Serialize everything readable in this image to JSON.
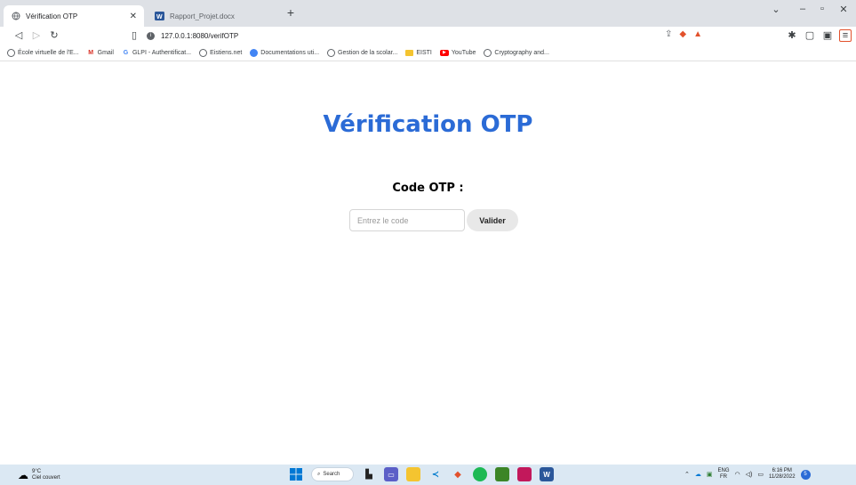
{
  "browser": {
    "tabs": [
      {
        "label": "Vérification OTP",
        "active": true
      },
      {
        "label": "Rapport_Projet.docx",
        "active": false
      }
    ],
    "address": "127.0.0.1:8080/verifOTP",
    "bookmarks": [
      {
        "label": "École virtuelle de l'E...",
        "icon": "globe-icon"
      },
      {
        "label": "Gmail",
        "icon": "gmail-icon"
      },
      {
        "label": "GLPI - Authentificat...",
        "icon": "google-icon"
      },
      {
        "label": "Eistiens.net",
        "icon": "globe-icon"
      },
      {
        "label": "Documentations uti...",
        "icon": "chrome-icon"
      },
      {
        "label": "Gestion de la scolar...",
        "icon": "globe-icon"
      },
      {
        "label": "EISTI",
        "icon": "folder-icon"
      },
      {
        "label": "YouTube",
        "icon": "youtube-icon"
      },
      {
        "label": "Cryptography and...",
        "icon": "globe-icon"
      }
    ]
  },
  "page": {
    "title": "Vérification OTP",
    "label": "Code OTP :",
    "input_placeholder": "Entrez le code",
    "submit_label": "Valider"
  },
  "taskbar": {
    "weather_temp": "9°C",
    "weather_desc": "Ciel couvert",
    "search_label": "Search",
    "lang_top": "ENG",
    "lang_bottom": "FR",
    "time": "6:16 PM",
    "date": "11/28/2022",
    "notification_count": "5"
  },
  "colors": {
    "title_blue": "#2b6bd6",
    "tabstrip_bg": "#dee1e6",
    "taskbar_bg": "#dbe8f3",
    "button_bg": "#e8e8e8"
  }
}
